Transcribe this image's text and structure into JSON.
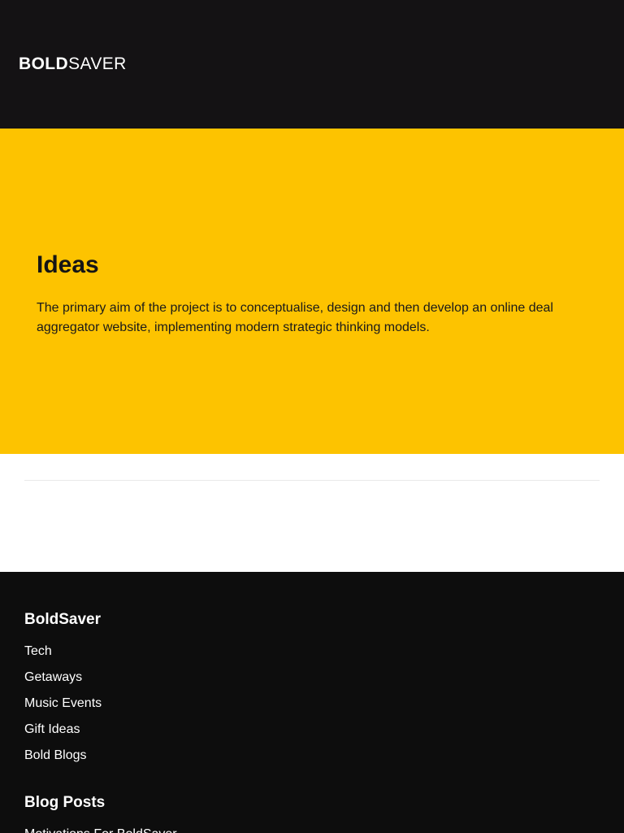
{
  "header": {
    "logo_bold": "BOLD",
    "logo_light": "SAVER"
  },
  "hero": {
    "title": "Ideas",
    "text": "The primary aim of the project is to conceptualise, design and then develop an online deal aggregator website, implementing modern strategic thinking models.",
    "background_color": "#fdc300"
  },
  "footer": {
    "brand_heading": "BoldSaver",
    "links": [
      "Tech",
      "Getaways",
      "Music Events",
      "Gift Ideas",
      "Bold Blogs"
    ],
    "posts_heading": "Blog Posts",
    "posts": [
      "Motivations For BoldSaver"
    ],
    "background_color": "#0d0d0d"
  },
  "colors": {
    "header_bg": "#141214",
    "accent": "#fdc300"
  }
}
